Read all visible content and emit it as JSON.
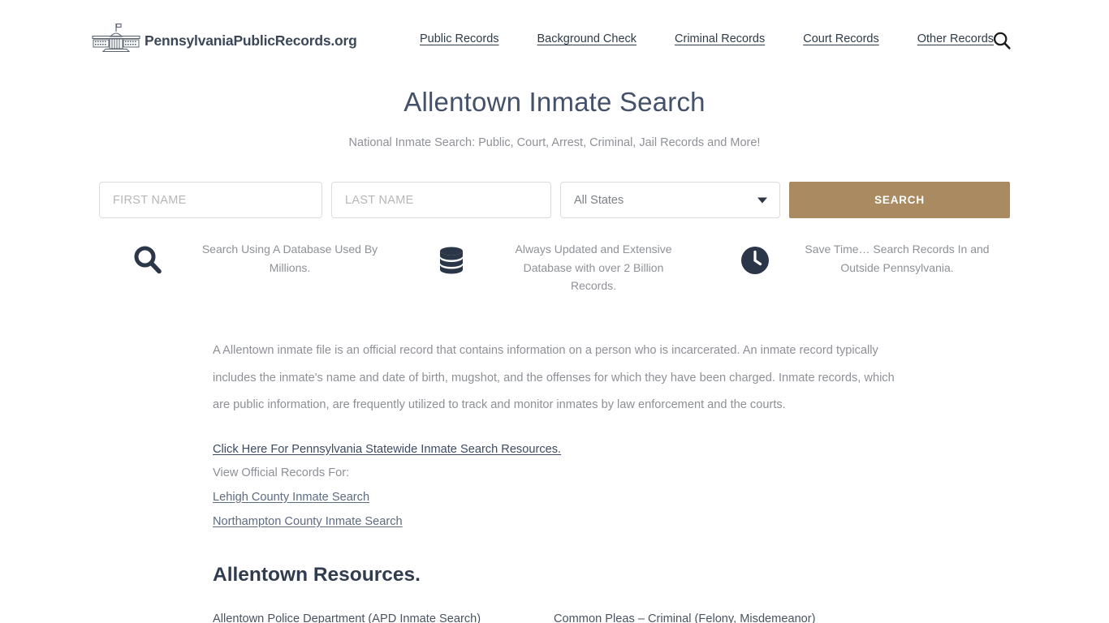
{
  "header": {
    "logo_text": "PennsylvaniaPublicRecords.org",
    "logo_icon": "capitol-building-icon",
    "search_icon": "search-icon",
    "nav": [
      {
        "label": "Public Records"
      },
      {
        "label": "Background Check"
      },
      {
        "label": "Criminal Records"
      },
      {
        "label": "Court Records"
      },
      {
        "label": "Other Records"
      }
    ]
  },
  "hero": {
    "title": "Allentown Inmate Search",
    "subtitle": "National Inmate Search: Public, Court, Arrest, Criminal, Jail Records and More!"
  },
  "search_form": {
    "first_name_placeholder": "FIRST NAME",
    "first_name_value": "",
    "last_name_placeholder": "LAST NAME",
    "last_name_value": "",
    "state_selected": "All States",
    "state_options": [
      "All States"
    ],
    "submit_label": "SEARCH",
    "submit_color": "#a98a61"
  },
  "features": [
    {
      "icon": "magnifier-icon",
      "text": "Search Using A Database Used By Millions."
    },
    {
      "icon": "database-icon",
      "text": "Always Updated and Extensive Database with over 2 Billion Records."
    },
    {
      "icon": "clock-icon",
      "text": "Save Time… Search Records In and Outside Pennsylvania."
    }
  ],
  "content": {
    "paragraph": "A Allentown inmate file is an official record that contains information on a person who is incarcerated. An inmate record typically includes the inmate's name and date of birth, mugshot, and the offenses for which they have been charged. Inmate records, which are public information, are frequently utilized to track and monitor inmates by law enforcement and the courts.",
    "statewide_link": "Click Here For Pennsylvania Statewide Inmate Search Resources.",
    "view_official_label": "View Official Records For:",
    "county_links": [
      {
        "label": "Lehigh County Inmate Search"
      },
      {
        "label": "Northampton County Inmate Search"
      }
    ]
  },
  "resources": {
    "heading": "Allentown Resources.",
    "columns": [
      {
        "items": [
          {
            "label": "Allentown Police Department (APD Inmate Search)"
          }
        ]
      },
      {
        "items": [
          {
            "label": "Common Pleas – Criminal (Felony, Misdemeanor)"
          }
        ]
      }
    ]
  },
  "colors": {
    "accent": "#a98a61",
    "heading": "#313d4f",
    "body_text": "#8d9096",
    "link": "#5d6b81",
    "background": "#ffffff"
  }
}
